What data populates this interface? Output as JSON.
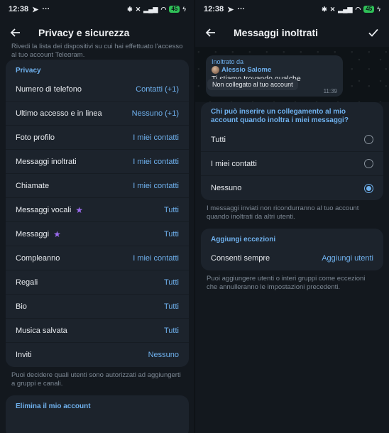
{
  "left": {
    "status": {
      "time": "12:38",
      "battery": "45"
    },
    "title": "Privacy e sicurezza",
    "intro": "Rivedi la lista dei dispositivi su cui hai effettuato l'accesso al tuo account Telegram.",
    "privacy": {
      "header": "Privacy",
      "rows": [
        {
          "label": "Numero di telefono",
          "value": "Contatti (+1)"
        },
        {
          "label": "Ultimo accesso e in linea",
          "value": "Nessuno (+1)"
        },
        {
          "label": "Foto profilo",
          "value": "I miei contatti"
        },
        {
          "label": "Messaggi inoltrati",
          "value": "I miei contatti"
        },
        {
          "label": "Chiamate",
          "value": "I miei contatti"
        },
        {
          "label": "Messaggi vocali",
          "value": "Tutti",
          "star": true
        },
        {
          "label": "Messaggi",
          "value": "Tutti",
          "star": true
        },
        {
          "label": "Compleanno",
          "value": "I miei contatti"
        },
        {
          "label": "Regali",
          "value": "Tutti"
        },
        {
          "label": "Bio",
          "value": "Tutti"
        },
        {
          "label": "Musica salvata",
          "value": "Tutti"
        },
        {
          "label": "Inviti",
          "value": "Nessuno"
        }
      ]
    },
    "note": "Puoi decidere quali utenti sono autorizzati ad aggiungerti a gruppi e canali.",
    "delete_header": "Elimina il mio account"
  },
  "right": {
    "status": {
      "time": "12:38",
      "battery": "45"
    },
    "title": "Messaggi inoltrati",
    "preview": {
      "forwarded_from": "Inoltrato da",
      "name": "Alessio Salome",
      "text": "Ti stiamo trovando qualche",
      "time": "11:39",
      "tooltip": "Non collegato al tuo account"
    },
    "question": "Chi può inserire un collegamento al mio account quando inoltra i miei messaggi?",
    "options": [
      {
        "label": "Tutti",
        "selected": false
      },
      {
        "label": "I miei contatti",
        "selected": false
      },
      {
        "label": "Nessuno",
        "selected": true
      }
    ],
    "note1": "I messaggi inviati non ricondurranno al tuo account quando inoltrati da altri utenti.",
    "exceptions_header": "Aggiungi eccezioni",
    "always_label": "Consenti sempre",
    "always_value": "Aggiungi utenti",
    "note2": "Puoi aggiungere utenti o interi gruppi come eccezioni che annulleranno le impostazioni precedenti."
  },
  "colors": {
    "accent": "#6fb1ee",
    "background": "#13181e",
    "card": "#1c232c",
    "star": "#9c6bf0"
  }
}
